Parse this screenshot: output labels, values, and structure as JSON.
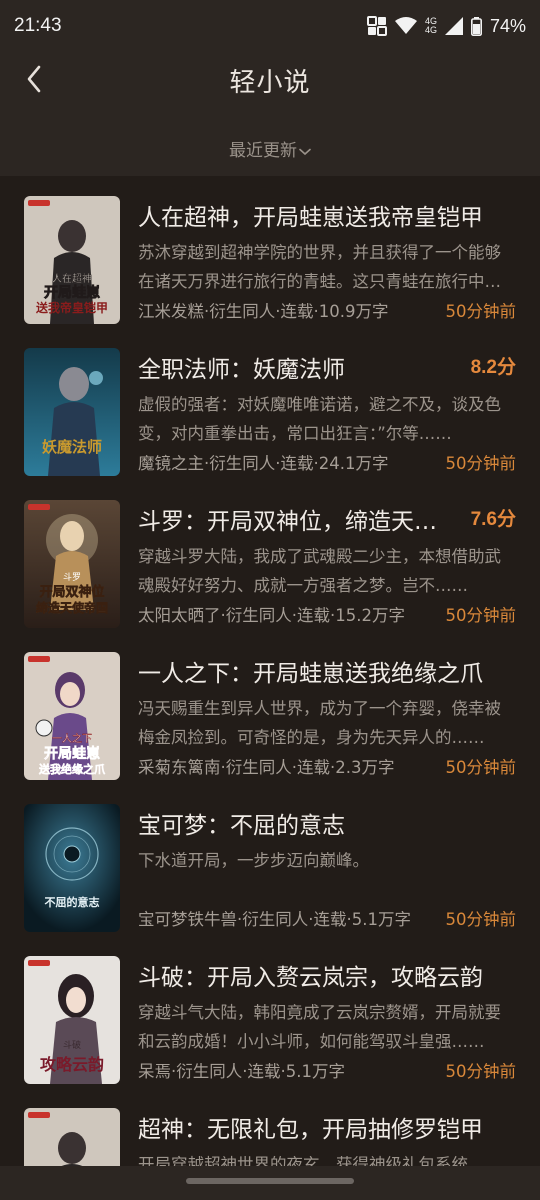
{
  "status_bar": {
    "time": "21:43",
    "network": "4G",
    "battery": "74%"
  },
  "header": {
    "title": "轻小说",
    "sort_label": "最近更新"
  },
  "books": [
    {
      "title": "人在超神，开局蛙崽送我帝皇铠甲",
      "score": "",
      "desc": "苏沐穿越到超神学院的世界，并且获得了一个能够在诸天万界进行旅行的青蛙。这只青蛙在旅行中会带回各种宝物……",
      "meta": "江米发糕·衍生同人·连载·10.9万字",
      "time": "50分钟前",
      "cover_text": "人在超神 开局蛙崽 送我帝皇铠甲",
      "cover_colors": [
        "#cfc7bd",
        "#2a2626",
        "#8a1c1c"
      ]
    },
    {
      "title": "全职法师：妖魔法师",
      "score": "8.2分",
      "desc": "虚假的强者：对妖魔唯唯诺诺，避之不及，谈及色变，对内重拳出击，常口出狂言：”尔等……",
      "meta": "魔镜之主·衍生同人·连载·24.1万字",
      "time": "50分钟前",
      "cover_text": "妖魔法师",
      "cover_colors": [
        "#1f5f7a",
        "#3d8fae",
        "#c99a2e"
      ]
    },
    {
      "title": "斗罗：开局双神位，缔造天使帝国",
      "score": "7.6分",
      "desc": "穿越斗罗大陆，我成了武魂殿二少主，本想借助武魂殿好好努力、成就一方强者之梦。岂不……",
      "meta": "太阳太晒了·衍生同人·连载·15.2万字",
      "time": "50分钟前",
      "cover_text": "斗罗 开局双神位 缔造天使帝国",
      "cover_colors": [
        "#3a2a22",
        "#b8905a",
        "#e8c27a"
      ]
    },
    {
      "title": "一人之下：开局蛙崽送我绝缘之爪",
      "score": "",
      "desc": "冯天赐重生到异人世界，成为了一个弃婴，侥幸被梅金凤捡到。可奇怪的是，身为先天异人的……",
      "meta": "采菊东篱南·衍生同人·连载·2.3万字",
      "time": "50分钟前",
      "cover_text": "一人之下 开局蛙崽 送我绝缘之爪",
      "cover_colors": [
        "#d9cfc5",
        "#6a4a8a",
        "#c0262a"
      ]
    },
    {
      "title": "宝可梦：不屈的意志",
      "score": "",
      "desc": "下水道开局，一步步迈向巅峰。",
      "meta": "宝可梦铁牛兽·衍生同人·连载·5.1万字",
      "time": "50分钟前",
      "cover_text": "不屈的意志",
      "cover_colors": [
        "#0e2430",
        "#3b7a94",
        "#9ccbd8"
      ]
    },
    {
      "title": "斗破：开局入赘云岚宗，攻略云韵",
      "score": "",
      "desc": "穿越斗气大陆，韩阳竟成了云岚宗赘婿，开局就要和云韵成婚！小小斗师，如何能驾驭斗皇强……",
      "meta": "呆焉·衍生同人·连载·5.1万字",
      "time": "50分钟前",
      "cover_text": "斗破 攻略云韵",
      "cover_colors": [
        "#e6e2de",
        "#3a3032",
        "#9a2a3a"
      ]
    },
    {
      "title": "超神：无限礼包，开局抽修罗铠甲",
      "score": "",
      "desc": "开局穿越超神世界的夜玄，获得神级礼包系统，",
      "meta": "",
      "time": "",
      "cover_text": "",
      "cover_colors": [
        "#cfc7bd",
        "#2a2626",
        "#8a1c1c"
      ]
    }
  ]
}
